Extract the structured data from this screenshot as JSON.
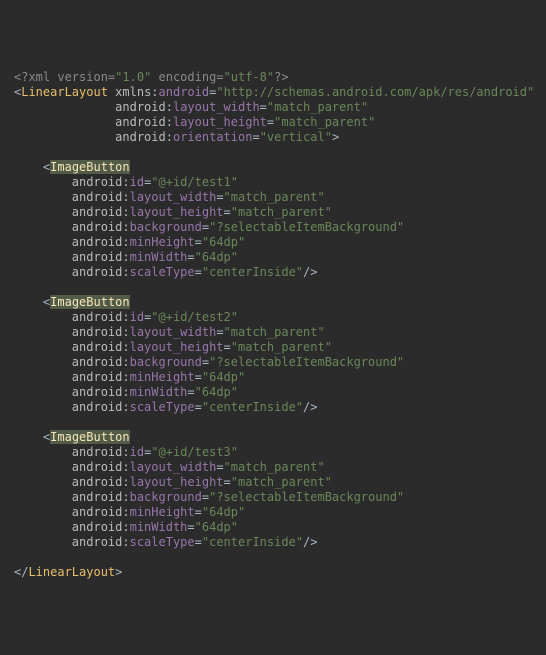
{
  "xml_decl": {
    "version": "1.0",
    "encoding": "utf-8"
  },
  "root": {
    "name": "LinearLayout",
    "xmlns": "http://schemas.android.com/apk/res/android",
    "layout_width": "match_parent",
    "layout_height": "match_parent",
    "orientation": "vertical"
  },
  "buttons": [
    {
      "id": "@+id/test1",
      "layout_width": "match_parent",
      "layout_height": "match_parent",
      "background": "?selectableItemBackground",
      "minHeight": "64dp",
      "minWidth": "64dp",
      "scaleType": "centerInside"
    },
    {
      "id": "@+id/test2",
      "layout_width": "match_parent",
      "layout_height": "match_parent",
      "background": "?selectableItemBackground",
      "minHeight": "64dp",
      "minWidth": "64dp",
      "scaleType": "centerInside"
    },
    {
      "id": "@+id/test3",
      "layout_width": "match_parent",
      "layout_height": "match_parent",
      "background": "?selectableItemBackground",
      "minHeight": "64dp",
      "minWidth": "64dp",
      "scaleType": "centerInside"
    }
  ],
  "close_tag": "LinearLayout"
}
